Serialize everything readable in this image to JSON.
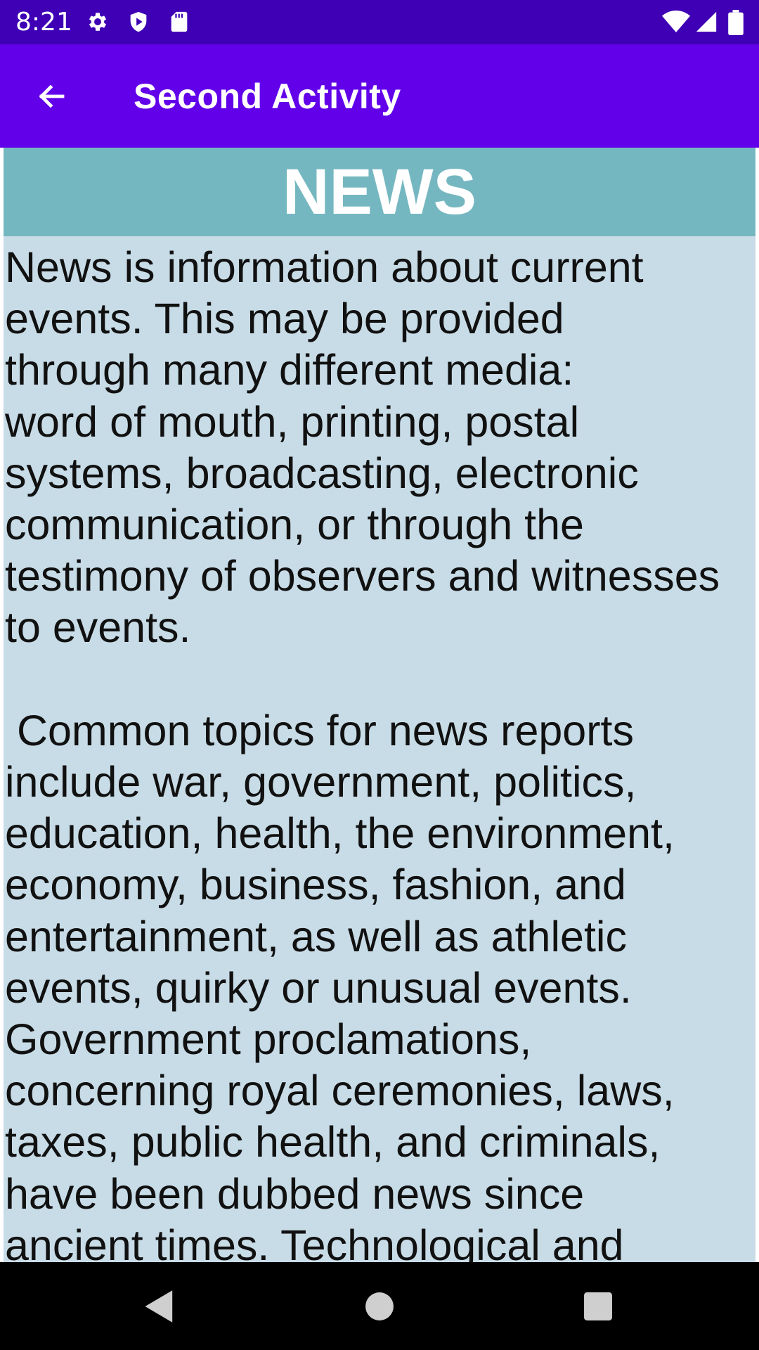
{
  "status_bar": {
    "time": "8:21",
    "icons": [
      "gear-icon",
      "play-shield-icon",
      "sd-card-icon",
      "wifi-icon",
      "signal-icon",
      "battery-icon"
    ],
    "background": "#3f00b5"
  },
  "app_bar": {
    "title": "Second Activity",
    "back_icon": "arrow-left-icon",
    "background": "#6200ea"
  },
  "content": {
    "header": "NEWS",
    "header_background": "#75b7c0",
    "body_background": "#c8dce7",
    "body_lines": [
      "News is information about current",
      "events. This may be provided",
      "through many different media:",
      "word of mouth, printing, postal",
      "systems, broadcasting, electronic",
      "communication, or through the",
      "testimony of observers and witnesses",
      "to events.",
      "",
      " Common topics for news reports",
      "include war, government, politics,",
      "education, health, the environment,",
      "economy, business, fashion, and",
      "entertainment, as well as athletic",
      "events, quirky or unusual events.",
      "Government proclamations,",
      "concerning royal ceremonies, laws,",
      "taxes, public health, and criminals,",
      "have been dubbed news since",
      "ancient times. Technological and"
    ]
  },
  "nav_bar": {
    "buttons": [
      "back-triangle-icon",
      "home-circle-icon",
      "recents-square-icon"
    ]
  }
}
